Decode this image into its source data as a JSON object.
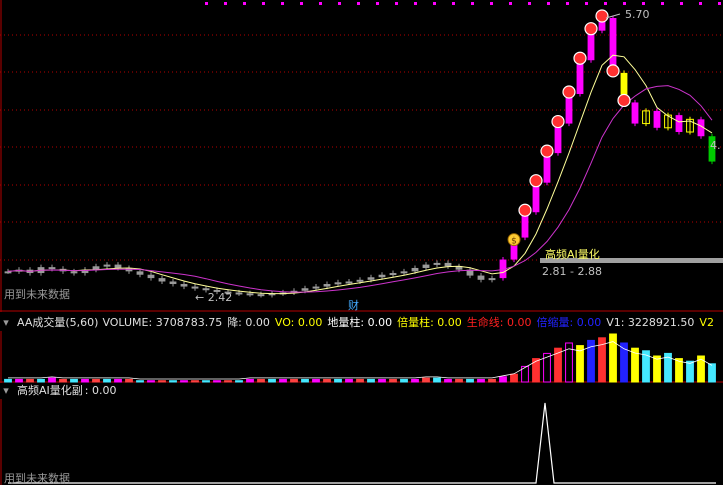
{
  "colors": {
    "background": "#000000",
    "grid_red": "#b30000",
    "up_magenta": "#ff00ff",
    "yellow": "#ffff00",
    "gray": "#9a9a9a",
    "green": "#00cc00",
    "cyan": "#44e8ff",
    "blue": "#2222ff",
    "label_red": "#ff2020",
    "white": "#ffffff",
    "ma_white": "#ffff99",
    "ma_magenta": "#cc33cc"
  },
  "main_panel": {
    "future_data_label": "用到未来数据",
    "high_label": "5.70",
    "low_label": "2.42",
    "right_label": "4.",
    "range_label": "2.81 - 2.88",
    "strategy_label": "高频AI量化",
    "finance_icon_text": "财",
    "coin_icon_text": "$"
  },
  "volume_panel": {
    "title": "AA成交量(5,60)",
    "indicators": [
      {
        "label": "VOLUME:",
        "value": "3708783.75",
        "color": "#e0e0e0"
      },
      {
        "label": "降:",
        "value": "0.00",
        "color": "#e0e0e0"
      },
      {
        "label": "VO:",
        "value": "0.00",
        "color": "#ffff00"
      },
      {
        "label": "地量柱:",
        "value": "0.00",
        "color": "#ffffff"
      },
      {
        "label": "倍量柱:",
        "value": "0.00",
        "color": "#ffff00"
      },
      {
        "label": "生命线:",
        "value": "0.00",
        "color": "#ff2020"
      },
      {
        "label": "倍缩量:",
        "value": "0.00",
        "color": "#2222ff"
      },
      {
        "label": "V1:",
        "value": "3228921.50",
        "color": "#e0e0e0"
      },
      {
        "label": "V2",
        "value": "",
        "color": "#ffff00"
      }
    ]
  },
  "sub_panel": {
    "title": "高频AI量化副",
    "value": ": 0.00",
    "future_data_label": "用到未来数据"
  },
  "chart_data": {
    "type": "candlestick",
    "closes_approx": [
      2.7,
      2.72,
      2.68,
      2.75,
      2.73,
      2.7,
      2.68,
      2.72,
      2.76,
      2.78,
      2.74,
      2.7,
      2.66,
      2.62,
      2.58,
      2.55,
      2.52,
      2.5,
      2.48,
      2.46,
      2.45,
      2.44,
      2.43,
      2.42,
      2.44,
      2.45,
      2.47,
      2.5,
      2.52,
      2.55,
      2.57,
      2.58,
      2.6,
      2.63,
      2.66,
      2.68,
      2.7,
      2.74,
      2.78,
      2.8,
      2.76,
      2.72,
      2.65,
      2.6,
      2.62,
      2.84,
      3.1,
      3.4,
      3.75,
      4.1,
      4.45,
      4.8,
      5.2,
      5.55,
      5.7,
      5.05,
      4.7,
      4.45,
      4.6,
      4.4,
      4.55,
      4.35,
      4.5,
      4.3,
      4.0
    ],
    "high": 5.7,
    "low": 2.42
  }
}
